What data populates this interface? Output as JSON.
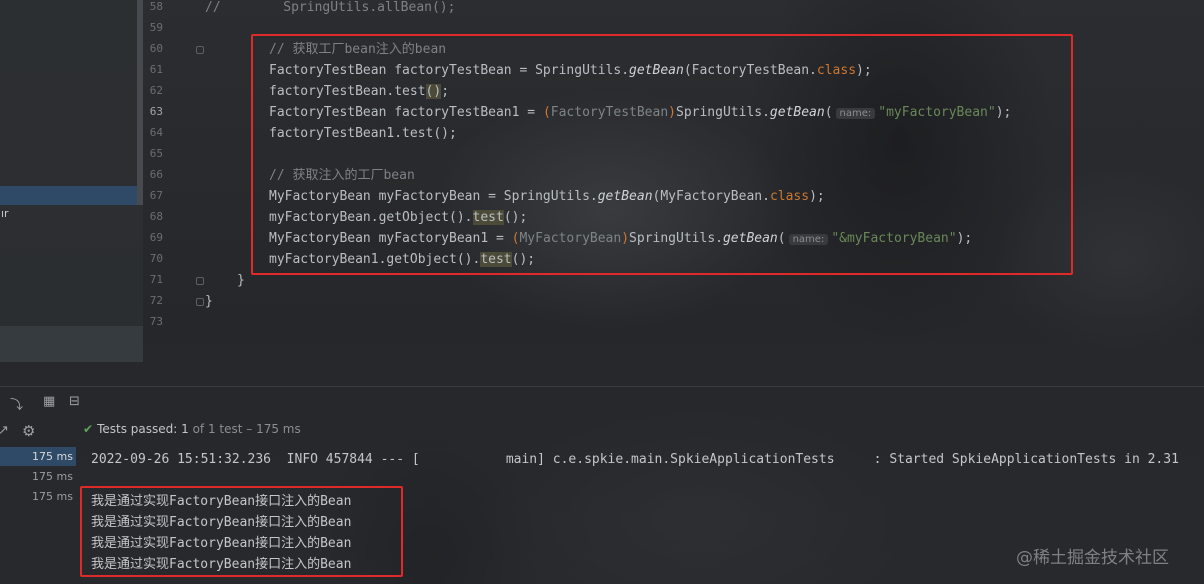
{
  "left_panel": {
    "truncated_label": "ır"
  },
  "editor": {
    "lines": [
      {
        "num": "58",
        "text": "//        SpringUtils.allBean();"
      },
      {
        "num": "59"
      },
      {
        "num": "60",
        "text": "// 获取工厂bean注入的bean"
      },
      {
        "num": "61",
        "p1": "FactoryTestBean factoryTestBean = SpringUtils.",
        "fn": "getBean",
        "p2": "(FactoryTestBean.",
        "kw": "class",
        "p3": ");"
      },
      {
        "num": "62",
        "p1": "factoryTestBean.test",
        "paren": "()",
        "p2": ";"
      },
      {
        "num": "63",
        "p1": "FactoryTestBean factoryTestBean1 = ",
        "cast_open": "(",
        "cast": "FactoryTestBean",
        "cast_close": ")",
        "p2": "SpringUtils.",
        "fn": "getBean",
        "p3": "(",
        "hint": "name:",
        "str": "\"myFactoryBean\"",
        "p4": ");"
      },
      {
        "num": "64",
        "text": "factoryTestBean1.test();"
      },
      {
        "num": "65"
      },
      {
        "num": "66",
        "text": "// 获取注入的工厂bean"
      },
      {
        "num": "67",
        "p1": "MyFactoryBean myFactoryBean = SpringUtils.",
        "fn": "getBean",
        "p2": "(MyFactoryBean.",
        "kw": "class",
        "p3": ");"
      },
      {
        "num": "68",
        "p1": "myFactoryBean.getObject().",
        "hl": "test",
        "p2": "();"
      },
      {
        "num": "69",
        "p1": "MyFactoryBean myFactoryBean1 = ",
        "cast_open": "(",
        "cast": "MyFactoryBean",
        "cast_close": ")",
        "p2": "SpringUtils.",
        "fn": "getBean",
        "p3": "(",
        "hint": "name:",
        "str": "\"&myFactoryBean\"",
        "p4": ");"
      },
      {
        "num": "70",
        "p1": "myFactoryBean1.getObject().",
        "hl": "test",
        "p2": "();"
      },
      {
        "num": "71",
        "text": "}"
      },
      {
        "num": "72",
        "text": "}"
      },
      {
        "num": "73"
      }
    ]
  },
  "run_panel": {
    "status": {
      "prefix": "Tests passed:",
      "passed": "1",
      "rest": "of 1 test – 175 ms"
    },
    "tree_rows": [
      "175 ms",
      "175 ms",
      "175 ms"
    ],
    "console": [
      "2022-09-26 15:51:32.236  INFO 457844 --- [           main] c.e.spkie.main.SpkieApplicationTests     : Started SpkieApplicationTests in 2.31",
      "我是通过实现FactoryBean接口注入的Bean",
      "我是通过实现FactoryBean接口注入的Bean",
      "我是通过实现FactoryBean接口注入的Bean",
      "我是通过实现FactoryBean接口注入的Bean"
    ]
  },
  "watermark": "@稀土掘金技术社区",
  "colors": {
    "highlight_box": "#e02a2a",
    "keyword": "#cc7832",
    "string": "#6a8759",
    "pass": "#5fa35a",
    "selection": "#2e4a66"
  }
}
